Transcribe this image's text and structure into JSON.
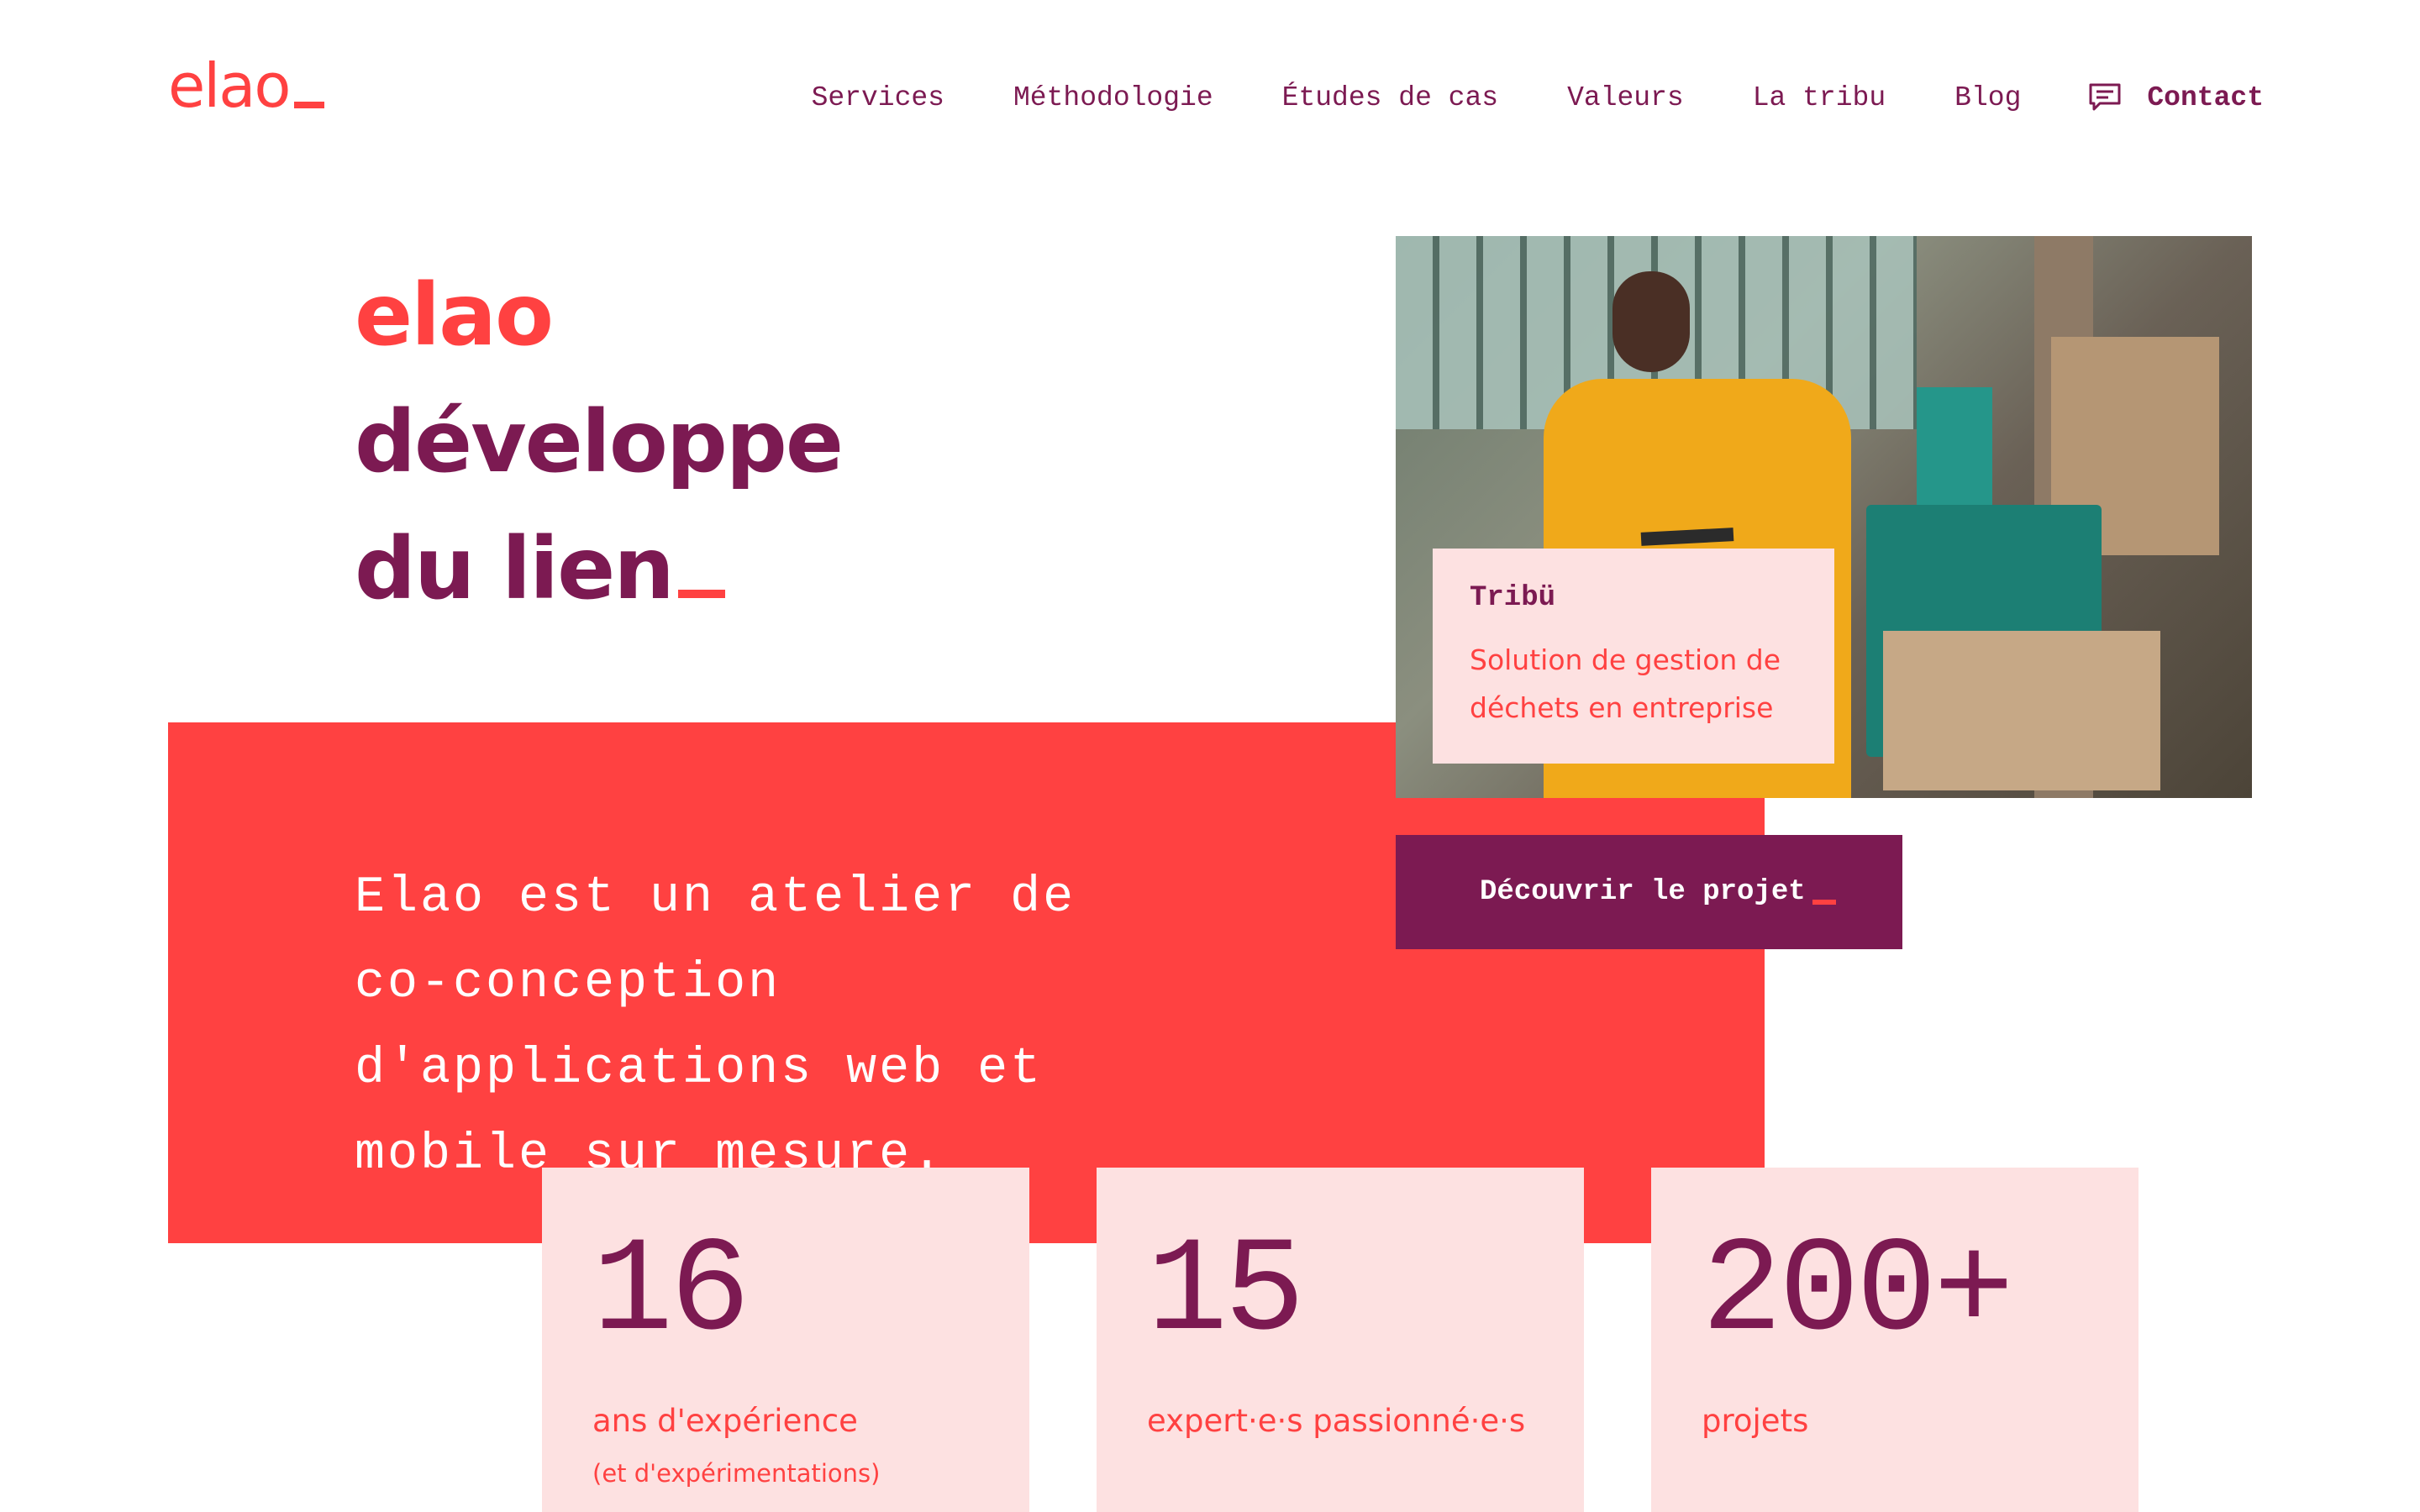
{
  "header": {
    "logo": "elao",
    "nav": [
      "Services",
      "Méthodologie",
      "Études de cas",
      "Valeurs",
      "La tribu",
      "Blog"
    ],
    "contact": "Contact"
  },
  "hero": {
    "line1": "elao",
    "line2": "développe",
    "line3": "du lien",
    "intro": "Elao est un atelier de co-conception d'applications web et mobile sur mesure."
  },
  "project": {
    "title": "Tribü",
    "description": "Solution de gestion de déchets en entreprise",
    "cta": "Découvrir le projet"
  },
  "stats": [
    {
      "number": "16",
      "label": "ans d'expérience",
      "sub": "(et d'expérimentations)"
    },
    {
      "number": "15",
      "label": "expert·e·s passionné·e·s",
      "sub": ""
    },
    {
      "number": "200+",
      "label": "projets",
      "sub": ""
    }
  ],
  "colors": {
    "accent": "#ff4141",
    "brand": "#7c1a52",
    "pink": "#fde1e1"
  },
  "icons": {
    "contact": "chat-bubble-icon"
  }
}
